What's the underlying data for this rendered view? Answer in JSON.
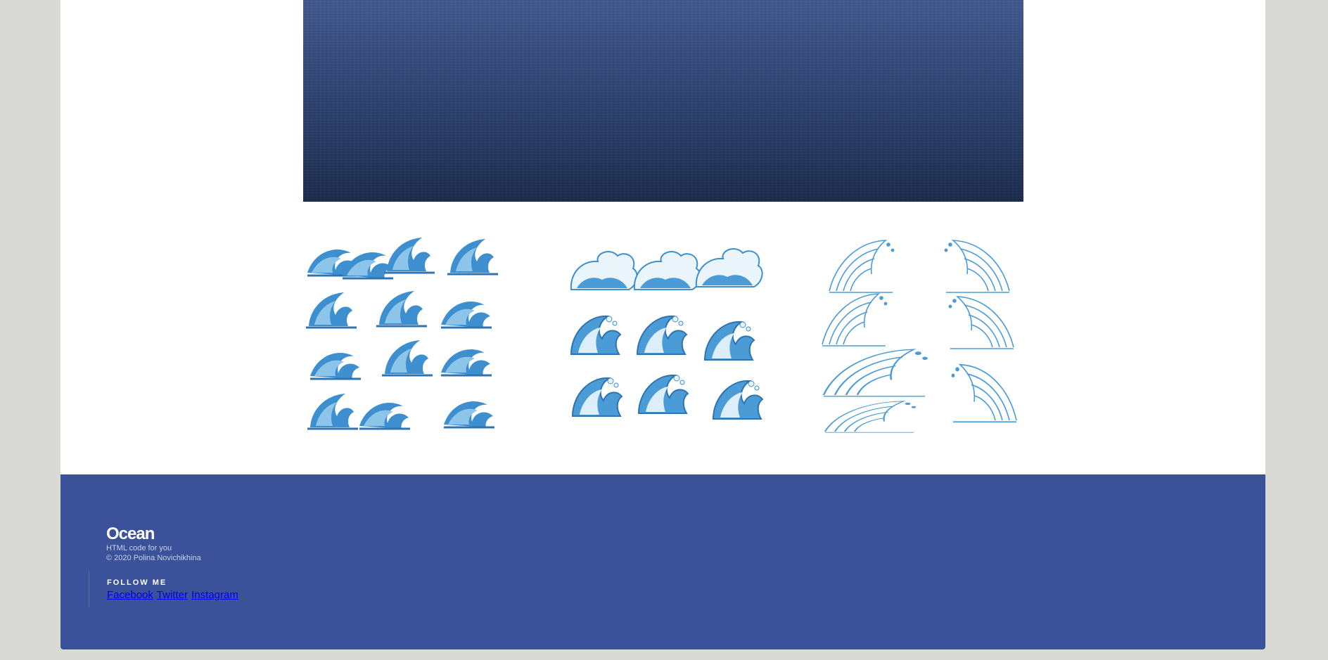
{
  "hero": {
    "image": "ocean-surface-photo"
  },
  "gallery": {
    "items": [
      {
        "image": "wave-illustrations-set-1"
      },
      {
        "image": "wave-illustrations-set-2"
      },
      {
        "image": "wave-illustrations-set-3"
      }
    ]
  },
  "footer": {
    "brand": {
      "title": "Ocean",
      "tagline": "HTML code for you",
      "copyright": "© 2020 Polina Novichikhina"
    },
    "follow": {
      "title": "FOLLOW ME",
      "links": [
        "Facebook",
        "Twitter",
        "Instagram"
      ]
    },
    "background_color": "#3b5199"
  },
  "colors": {
    "page_bg": "#d9d9d5",
    "wave_blue": "#3d8fcf",
    "wave_light": "#8cc4ea",
    "link": "#0000ee"
  }
}
